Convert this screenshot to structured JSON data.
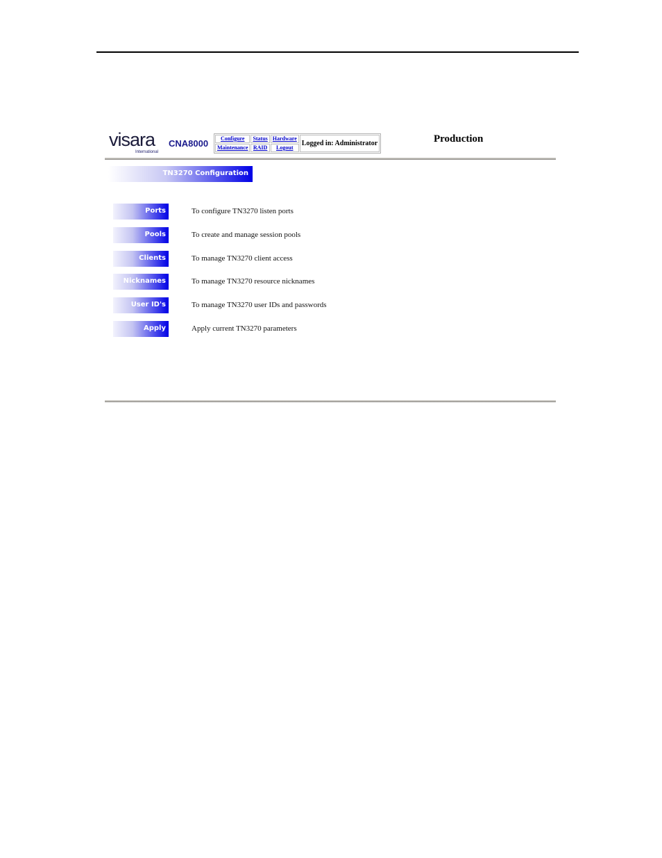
{
  "header": {
    "logo_text": "visara",
    "logo_subtext": "International",
    "product": "CNA8000",
    "nav": {
      "configure": "Configure",
      "status": "Status",
      "hardware": "Hardware",
      "maintenance": "Maintenance",
      "raid": "RAID",
      "logout": "Logout"
    },
    "logged_in": "Logged in: Administrator",
    "environment": "Production"
  },
  "section_title": "TN3270 Configuration",
  "menu": [
    {
      "label": "Ports",
      "description": "To configure TN3270 listen ports"
    },
    {
      "label": "Pools",
      "description": "To create and manage session pools"
    },
    {
      "label": "Clients",
      "description": "To manage TN3270 client access"
    },
    {
      "label": "Nicknames",
      "description": "To manage TN3270 resource nicknames"
    },
    {
      "label": "User ID's",
      "description": "To manage TN3270 user IDs and passwords"
    },
    {
      "label": "Apply",
      "description": "Apply current TN3270 parameters"
    }
  ],
  "colors": {
    "accent_blue": "#0000e6",
    "link_blue": "#0000cc",
    "product_blue": "#1a1a8c"
  }
}
